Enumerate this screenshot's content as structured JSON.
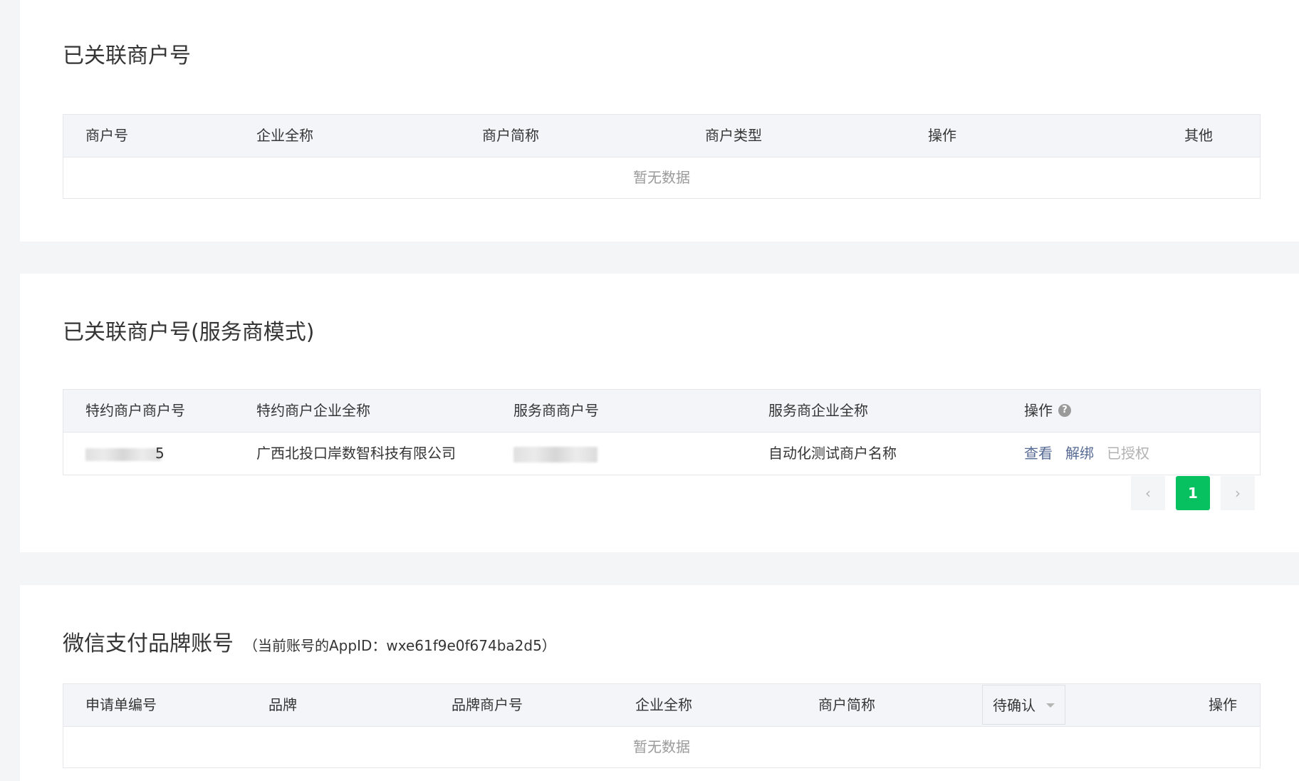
{
  "section_linked": {
    "title": "已关联商户号",
    "columns": [
      "商户号",
      "企业全称",
      "商户简称",
      "商户类型",
      "操作",
      "其他"
    ],
    "empty_text": "暂无数据"
  },
  "section_service": {
    "title": "已关联商户号(服务商模式)",
    "columns": [
      "特约商户商户号",
      "特约商户企业全称",
      "服务商商户号",
      "服务商企业全称",
      "操作"
    ],
    "rows": [
      {
        "merchant_id_tail": "5",
        "company_name": "广西北投口岸数智科技有限公司",
        "service_merchant_id_tail": "",
        "service_company_name": "自动化测试商户名称",
        "actions": {
          "view": "查看",
          "unbind": "解绑",
          "authorized": "已授权"
        }
      }
    ],
    "pagination": {
      "prev": "‹",
      "current": "1",
      "next": "›"
    }
  },
  "section_brand": {
    "title": "微信支付品牌账号",
    "subtitle": "（当前账号的AppID：wxe61f9e0f674ba2d5）",
    "columns": [
      "申请单编号",
      "品牌",
      "品牌商户号",
      "企业全称",
      "商户简称",
      "操作"
    ],
    "status_filter": "待确认",
    "empty_text": "暂无数据"
  },
  "colors": {
    "brand_green": "#07c160",
    "link": "#576b95",
    "link_disabled": "#b2b2b2",
    "header_bg": "#f4f5f9",
    "page_bg": "#f4f5f7"
  },
  "icons": {
    "help": "question-circle-icon",
    "caret": "caret-down-icon",
    "prev": "chevron-left-icon",
    "next": "chevron-right-icon"
  }
}
